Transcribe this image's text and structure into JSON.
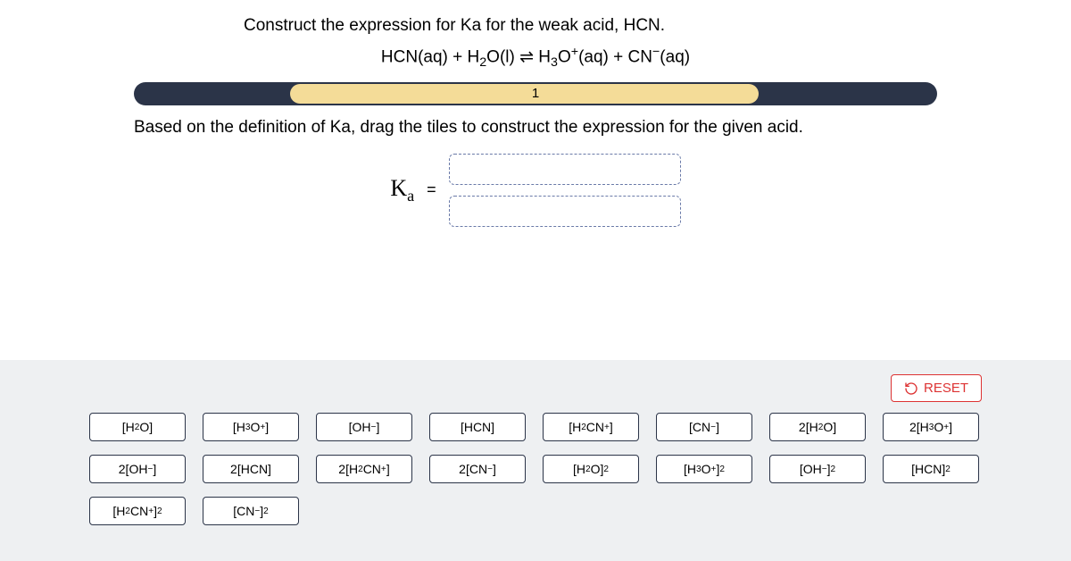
{
  "prompt": "Construct the expression for Ka for the weak acid, HCN.",
  "equation_html": "HCN(aq) + H<span class='sub'>2</span>O(l) ⇌ H<span class='sub'>3</span>O<span class='sup'>+</span>(aq) + CN<span class='sup'>−</span>(aq)",
  "progress": {
    "label": "1"
  },
  "instruction": "Based on the definition of Ka, drag the tiles to construct the expression for the given acid.",
  "ka_html": "K<span class='ka-sub'>a</span>",
  "equals": "=",
  "reset": {
    "label": "RESET"
  },
  "tiles": [
    {
      "html": "[H<span class='sub'>2</span>O]",
      "name": "tile-h2o"
    },
    {
      "html": "[H<span class='sub'>3</span>O<span class='sup'>+</span>]",
      "name": "tile-h3o-plus"
    },
    {
      "html": "[OH<span class='sup'>−</span>]",
      "name": "tile-oh-minus"
    },
    {
      "html": "[HCN]",
      "name": "tile-hcn"
    },
    {
      "html": "[H<span class='sub'>2</span>CN<span class='sup'>+</span>]",
      "name": "tile-h2cn-plus"
    },
    {
      "html": "[CN<span class='sup'>−</span>]",
      "name": "tile-cn-minus"
    },
    {
      "html": "2[H<span class='sub'>2</span>O]",
      "name": "tile-2h2o"
    },
    {
      "html": "2[H<span class='sub'>3</span>O<span class='sup'>+</span>]",
      "name": "tile-2h3o-plus"
    },
    {
      "html": "2[OH<span class='sup'>−</span>]",
      "name": "tile-2oh-minus"
    },
    {
      "html": "2[HCN]",
      "name": "tile-2hcn"
    },
    {
      "html": "2[H<span class='sub'>2</span>CN<span class='sup'>+</span>]",
      "name": "tile-2h2cn-plus"
    },
    {
      "html": "2[CN<span class='sup'>−</span>]",
      "name": "tile-2cn-minus"
    },
    {
      "html": "[H<span class='sub'>2</span>O]<span class='sup'>2</span>",
      "name": "tile-h2o-sq"
    },
    {
      "html": "[H<span class='sub'>3</span>O<span class='sup'>+</span>]<span class='sup'>2</span>",
      "name": "tile-h3o-plus-sq"
    },
    {
      "html": "[OH<span class='sup'>−</span>]<span class='sup'>2</span>",
      "name": "tile-oh-minus-sq"
    },
    {
      "html": "[HCN]<span class='sup'>2</span>",
      "name": "tile-hcn-sq"
    },
    {
      "html": "[H<span class='sub'>2</span>CN<span class='sup'>+</span>]<span class='sup'>2</span>",
      "name": "tile-h2cn-plus-sq"
    },
    {
      "html": "[CN<span class='sup'>−</span>]<span class='sup'>2</span>",
      "name": "tile-cn-minus-sq"
    }
  ]
}
